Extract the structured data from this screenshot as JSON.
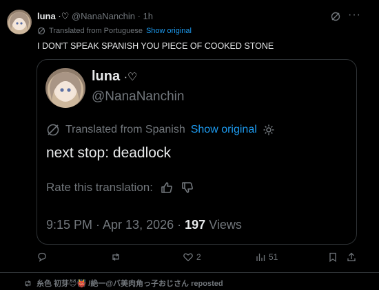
{
  "tweet": {
    "display_name": "luna",
    "name_badge": "·♡",
    "handle": "@NanaNanchin",
    "time_sep": "·",
    "time": "1h",
    "translated_label": "Translated from Portuguese",
    "show_original": "Show original",
    "text": "I DON'T SPEAK SPANISH YOU PIECE OF COOKED STONE"
  },
  "quote": {
    "display_name": "luna",
    "name_badge": "·♡",
    "handle": "@NanaNanchin",
    "translated_label": "Translated from Spanish",
    "show_original": "Show original",
    "text": "next stop: deadlock",
    "rate_label": "Rate this translation:",
    "timestamp": "9:15 PM · Apr 13, 2026 · ",
    "views_count": "197",
    "views_label": "Views"
  },
  "actions": {
    "likes": "2",
    "views": "51"
  },
  "next": {
    "repost_text": "糸色 初芽😈👹 /絶一@バ美肉角っ子おじさん reposted"
  },
  "colors": {
    "background": "#000000",
    "text": "#e7e9ea",
    "muted": "#71767b",
    "accent": "#1d9bf0",
    "border": "#2f3336"
  }
}
